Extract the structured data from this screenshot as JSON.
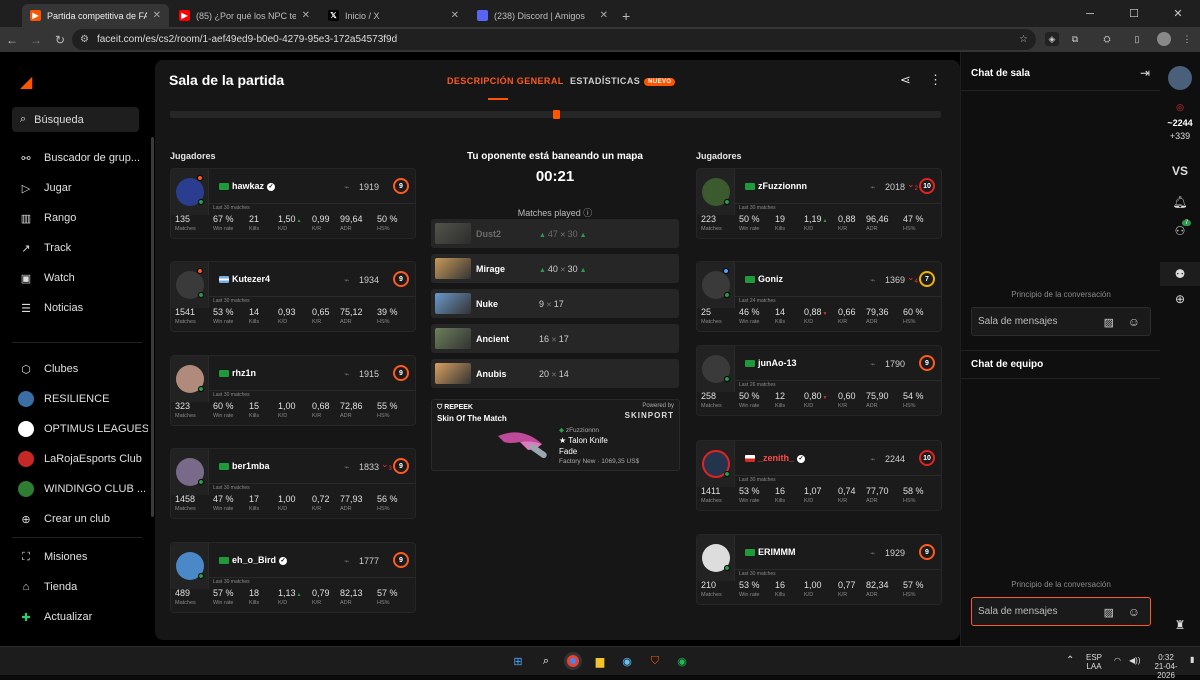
{
  "browser": {
    "tabs": [
      {
        "title": "Partida competitiva de FACEIT",
        "color": "#ff5500",
        "icon": "faceit-icon",
        "glyph": "▶",
        "active": true
      },
      {
        "title": "(85) ¿Por qué los NPC te golpean",
        "color": "#ff0000",
        "icon": "youtube-icon",
        "glyph": "▶",
        "active": false
      },
      {
        "title": "Inicio / X",
        "color": "#000000",
        "icon": "x-icon",
        "glyph": "𝕏",
        "active": false
      },
      {
        "title": "(238) Discord | Amigos",
        "color": "#5865f2",
        "icon": "discord-icon",
        "glyph": "238",
        "active": false
      }
    ],
    "url": "faceit.com/es/cs2/room/1-aef49ed9-b0e0-4279-95e3-172a54573f9d"
  },
  "sidebar": {
    "search_label": "Búsqueda",
    "items": [
      {
        "label": "Buscador de grup...",
        "icon": "group-finder-icon",
        "glyph": "⚯"
      },
      {
        "label": "Jugar",
        "icon": "play-icon",
        "glyph": "▷"
      },
      {
        "label": "Rango",
        "icon": "ranking-icon",
        "glyph": "▥"
      },
      {
        "label": "Track",
        "icon": "track-icon",
        "glyph": "↗"
      },
      {
        "label": "Watch",
        "icon": "watch-icon",
        "glyph": "▣"
      },
      {
        "label": "Noticias",
        "icon": "news-icon",
        "glyph": "☰"
      }
    ],
    "clubs": [
      {
        "label": "Clubes",
        "icon": "clubs-icon",
        "glyph": "⬡"
      },
      {
        "label": "RESILIENCE",
        "icon": "resilience-club-icon",
        "color": "#3a6ea5"
      },
      {
        "label": "OPTIMUS LEAGUES",
        "icon": "optimus-club-icon",
        "color": "#ffffff"
      },
      {
        "label": "LaRojaEsports Club",
        "icon": "laroja-club-icon",
        "color": "#c62828"
      },
      {
        "label": "WINDINGO CLUB ...",
        "icon": "windingo-club-icon",
        "color": "#2e7d32"
      },
      {
        "label": "Crear un club",
        "icon": "plus-circle-icon",
        "glyph": "⊕"
      }
    ],
    "bottom": [
      {
        "label": "Misiones",
        "icon": "missions-icon",
        "glyph": "⛶"
      },
      {
        "label": "Tienda",
        "icon": "store-icon",
        "glyph": "⌂"
      },
      {
        "label": "Actualizar",
        "icon": "upgrade-icon",
        "glyph": "✚"
      }
    ]
  },
  "room": {
    "title": "Sala de la partida",
    "tab_overview": "DESCRIPCIÓN GENERAL",
    "tab_stats": "ESTADÍSTICAS",
    "new_badge": "NUEVO",
    "players_label": "Jugadores",
    "veto_title": "Tu oponente está baneando un mapa",
    "timer": "00:21",
    "matches_played_label": "Matches played",
    "stat_labels": [
      "Matches",
      "Win rate",
      "Kills",
      "K/D",
      "K/R",
      "ADR",
      "HS%"
    ],
    "last_label_default": "Last 30 matches"
  },
  "team_left": [
    {
      "name": "hawkaz",
      "flag": "br",
      "verified": true,
      "elo": "1919",
      "level": "9",
      "level_color": "orange",
      "trend": "",
      "last": "Last 30 matches",
      "matches": "135",
      "winrate": "67 %",
      "kills": "21",
      "kd": "1,50",
      "kd_dir": "up",
      "kr": "0,99",
      "adr": "99,64",
      "hs": "50 %",
      "avatar": "#2a3d8f",
      "status": "#ff5a1f"
    },
    {
      "name": "Kutezer4",
      "flag": "ar",
      "verified": false,
      "elo": "1934",
      "level": "9",
      "level_color": "orange",
      "trend": "",
      "last": "Last 30 matches",
      "matches": "1541",
      "winrate": "53 %",
      "kills": "14",
      "kd": "0,93",
      "kd_dir": "",
      "kr": "0,65",
      "adr": "75,12",
      "hs": "39 %",
      "avatar": "#3a3a3a",
      "status": "#ff5a1f"
    },
    {
      "name": "rhz1n",
      "flag": "br",
      "verified": false,
      "elo": "1915",
      "level": "9",
      "level_color": "orange",
      "trend": "",
      "last": "Last 30 matches",
      "matches": "323",
      "winrate": "60 %",
      "kills": "15",
      "kd": "1,00",
      "kd_dir": "",
      "kr": "0,68",
      "adr": "72,86",
      "hs": "55 %",
      "avatar": "#b08a7a",
      "status": ""
    },
    {
      "name": "ber1mba",
      "flag": "br",
      "verified": false,
      "elo": "1833",
      "level": "9",
      "level_color": "orange",
      "trend": "3",
      "last": "Last 30 matches",
      "matches": "1458",
      "winrate": "47 %",
      "kills": "17",
      "kd": "1,00",
      "kd_dir": "",
      "kr": "0,72",
      "adr": "77,93",
      "hs": "56 %",
      "avatar": "#7a6a8a",
      "status": ""
    },
    {
      "name": "eh_o_Bird",
      "flag": "br",
      "verified": true,
      "elo": "1777",
      "level": "9",
      "level_color": "orange",
      "trend": "",
      "last": "Last 30 matches",
      "matches": "489",
      "winrate": "57 %",
      "kills": "18",
      "kd": "1,13",
      "kd_dir": "up",
      "kr": "0,79",
      "adr": "82,13",
      "hs": "57 %",
      "avatar": "#4a88c8",
      "status": ""
    }
  ],
  "team_right": [
    {
      "name": "zFuzzionnn",
      "flag": "br",
      "verified": false,
      "elo": "2018",
      "level": "10",
      "level_color": "red",
      "trend": "2",
      "last": "Last 30 matches",
      "matches": "223",
      "winrate": "50 %",
      "kills": "19",
      "kd": "1,19",
      "kd_dir": "up",
      "kr": "0,88",
      "adr": "96,46",
      "hs": "47 %",
      "avatar": "#3b5a2e",
      "status": ""
    },
    {
      "name": "Goniz",
      "flag": "br",
      "verified": false,
      "elo": "1369",
      "level": "7",
      "level_color": "yellow",
      "trend": "4",
      "last": "Last 24 matches",
      "matches": "25",
      "winrate": "46 %",
      "kills": "14",
      "kd": "0,88",
      "kd_dir": "down",
      "kr": "0,66",
      "adr": "79,36",
      "hs": "60 %",
      "avatar": "#3a3a3a",
      "status": "#4aa3ff"
    },
    {
      "name": "junAo-13",
      "flag": "br",
      "verified": false,
      "elo": "1790",
      "level": "9",
      "level_color": "orange",
      "trend": "",
      "last": "Last 26 matches",
      "matches": "258",
      "winrate": "50 %",
      "kills": "12",
      "kd": "0,80",
      "kd_dir": "down",
      "kr": "0,60",
      "adr": "75,90",
      "hs": "54 %",
      "avatar": "#3a3a3a",
      "status": ""
    },
    {
      "name": "_zenith_",
      "flag": "cl",
      "verified": true,
      "elo": "2244",
      "level": "10",
      "level_color": "red",
      "trend": "",
      "last": "Last 30 matches",
      "matches": "1411",
      "winrate": "53 %",
      "kills": "16",
      "kd": "1,07",
      "kd_dir": "",
      "kr": "0,74",
      "adr": "77,70",
      "hs": "58 %",
      "avatar": "#25344d",
      "status": "",
      "highlight": true
    },
    {
      "name": "ERIMMM",
      "flag": "br",
      "verified": false,
      "elo": "1929",
      "level": "9",
      "level_color": "orange",
      "trend": "",
      "last": "Last 30 matches",
      "matches": "210",
      "winrate": "53 %",
      "kills": "16",
      "kd": "1,00",
      "kd_dir": "",
      "kr": "0,77",
      "adr": "82,34",
      "hs": "57 %",
      "avatar": "#dddddd",
      "status": ""
    }
  ],
  "maps": [
    {
      "name": "Dust2",
      "score_a": "47",
      "score_b": "30",
      "arrows": true,
      "banned": true,
      "thumb": "#8a8a7a"
    },
    {
      "name": "Mirage",
      "score_a": "40",
      "score_b": "30",
      "arrows": true,
      "banned": false,
      "thumb": "#c89a5a"
    },
    {
      "name": "Nuke",
      "score_a": "9",
      "score_b": "17",
      "arrows": false,
      "banned": false,
      "thumb": "#6a9acb"
    },
    {
      "name": "Ancient",
      "score_a": "16",
      "score_b": "17",
      "arrows": false,
      "banned": false,
      "thumb": "#6c7f5a"
    },
    {
      "name": "Anubis",
      "score_a": "20",
      "score_b": "14",
      "arrows": false,
      "banned": false,
      "thumb": "#d8a060"
    }
  ],
  "sotm": {
    "brand": "REPEEK",
    "title": "Skin Of The Match",
    "powered": "Powered by",
    "provider": "SKINPORT",
    "owner": "zFuzzionnn",
    "item": "★ Talon Knife",
    "finish": "Fade",
    "price": "Factory New · 1069,35 US$"
  },
  "chat": {
    "room_title": "Chat de sala",
    "team_title": "Chat de equipo",
    "start_hint": "Principio de la conversación",
    "placeholder": "Sala de mensajes"
  },
  "rail": {
    "elo": "~2244",
    "delta": "+339",
    "vs": "VS",
    "friends_badge": "7",
    "level": "10"
  },
  "taskbar": {
    "lang1": "ESP",
    "lang2": "LAA",
    "time": "0:32",
    "date": "21-04-2026"
  }
}
